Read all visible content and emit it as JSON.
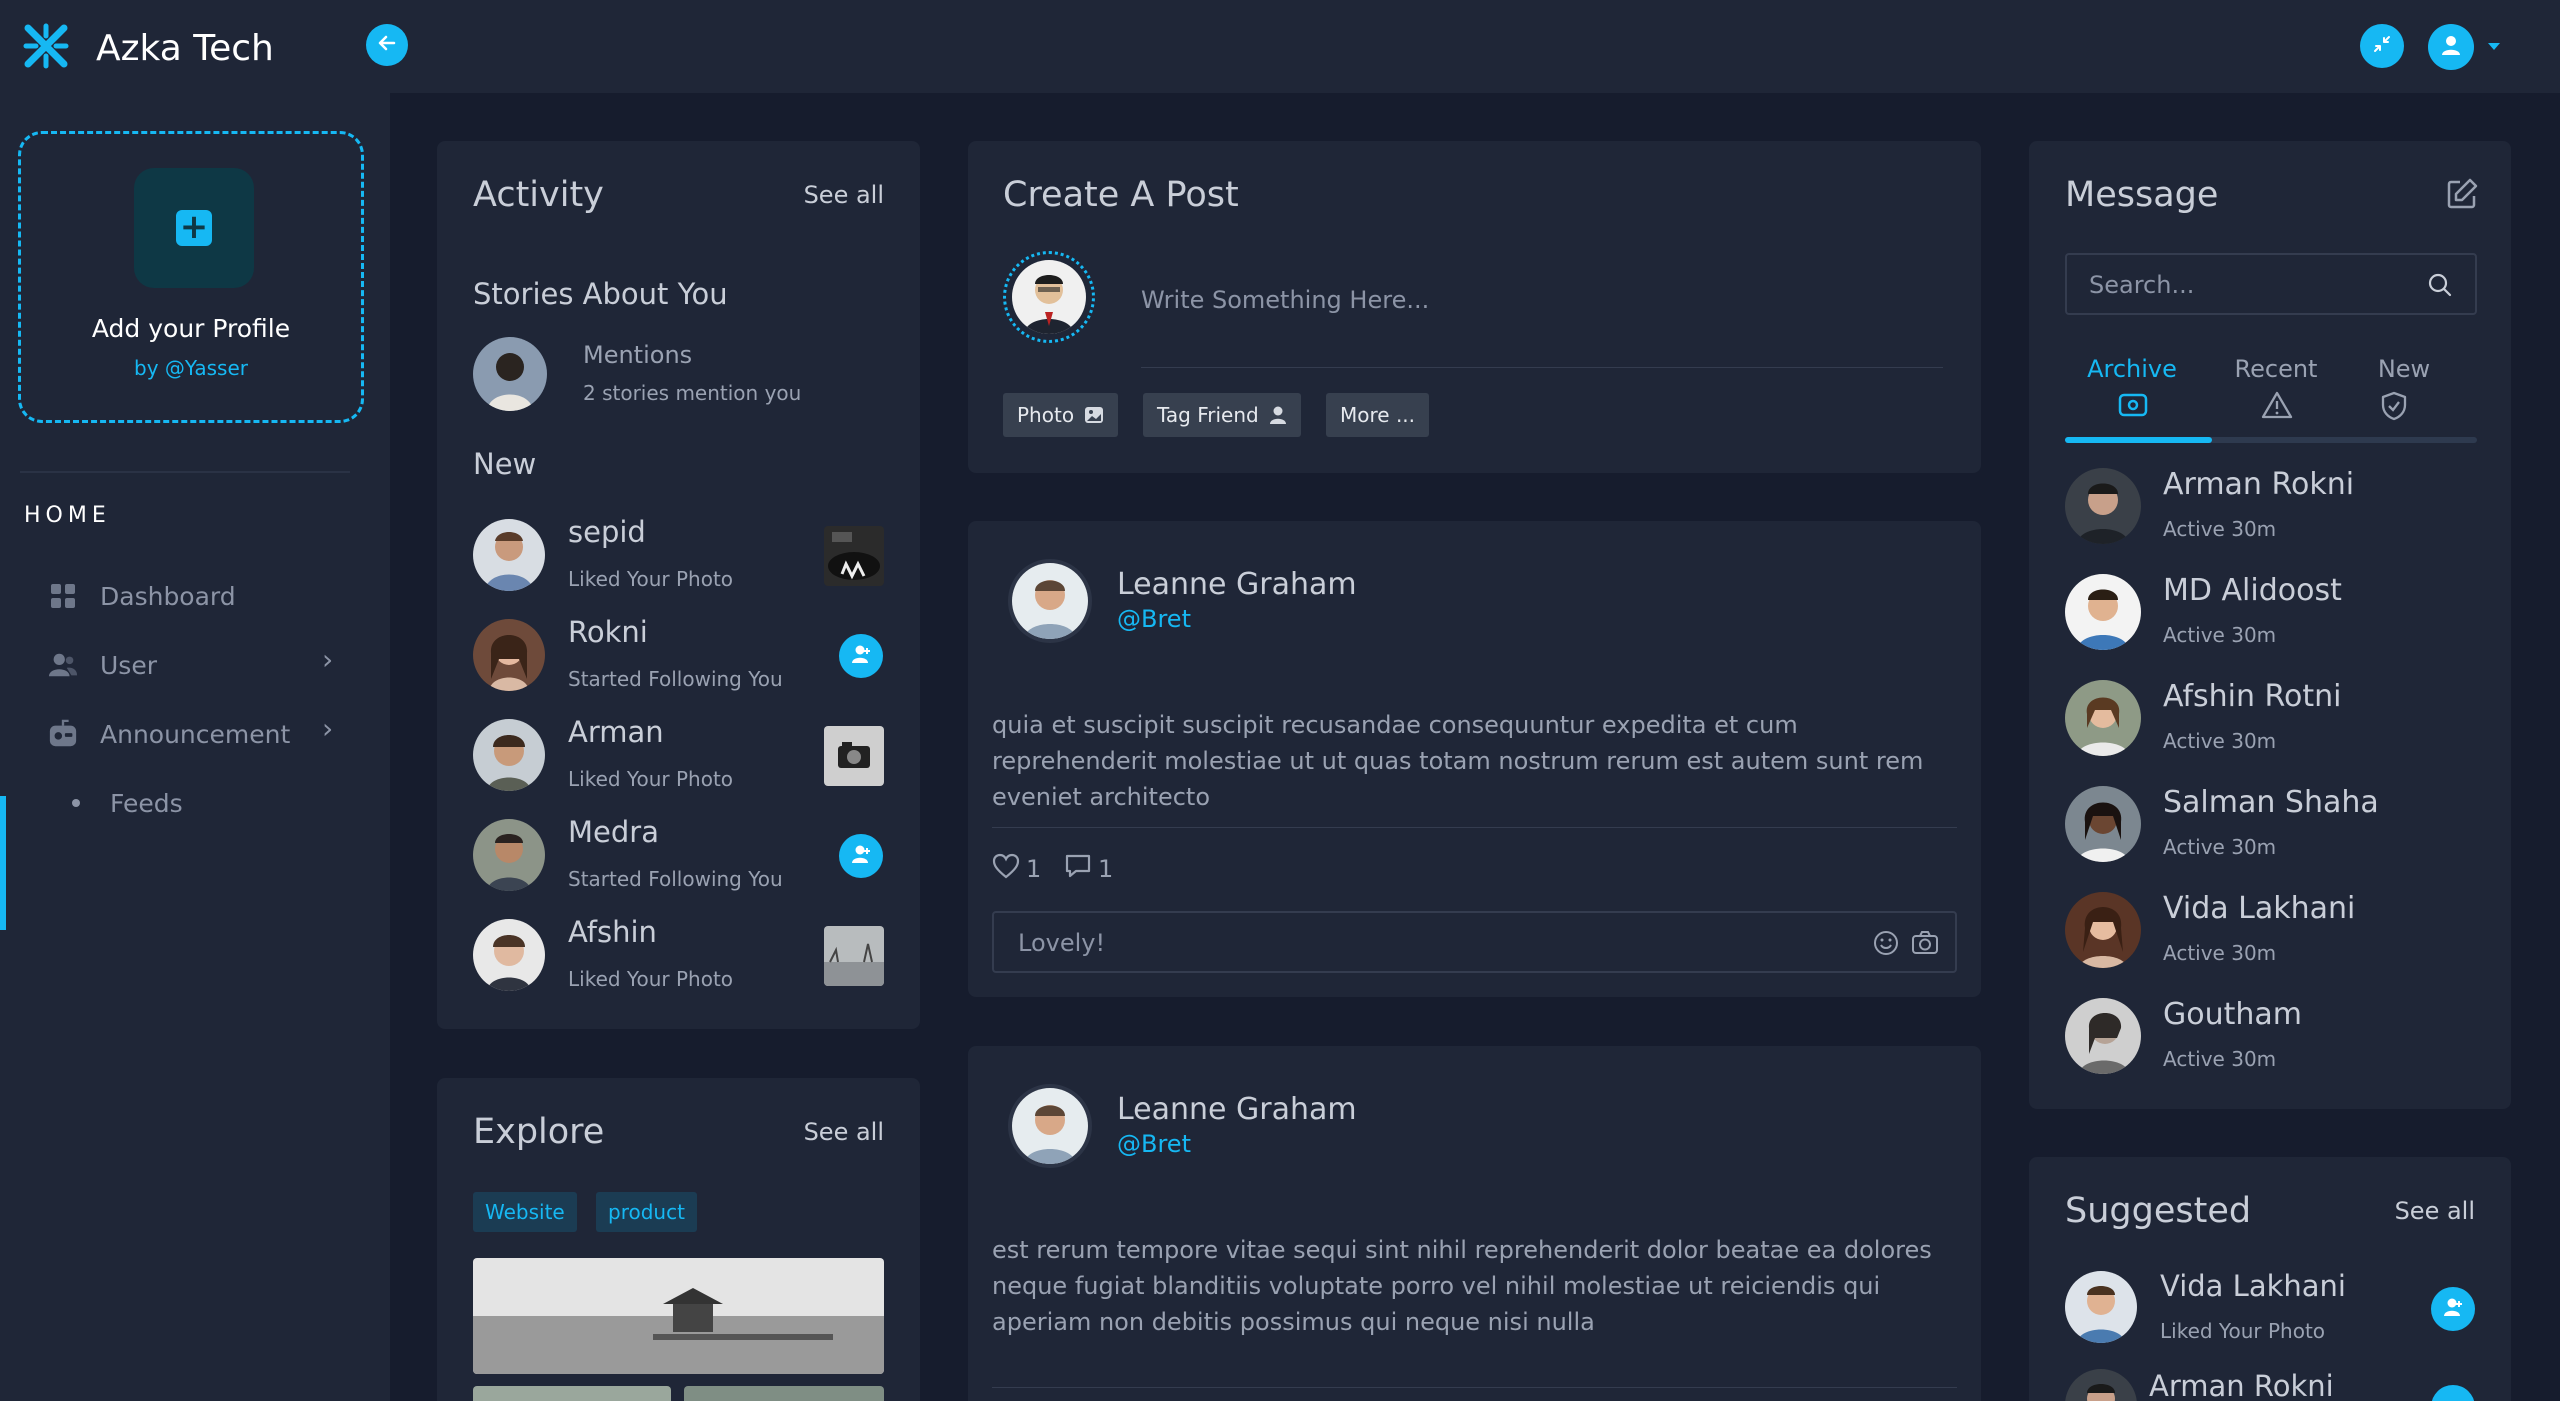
{
  "app": {
    "title": "Azka Tech"
  },
  "sidebar": {
    "profile": {
      "title": "Add your Profile",
      "subtitle": "by @Yasser"
    },
    "section_label": "HOME",
    "items": [
      {
        "label": "Dashboard"
      },
      {
        "label": "User"
      },
      {
        "label": "Announcement"
      },
      {
        "label": "Feeds"
      }
    ]
  },
  "activity": {
    "title": "Activity",
    "see_all": "See all",
    "stories_heading": "Stories About You",
    "mentions": {
      "title": "Mentions",
      "sub": "2 stories mention you"
    },
    "new_heading": "New",
    "items": [
      {
        "name": "sepid",
        "action": "Liked Your Photo"
      },
      {
        "name": "Rokni",
        "action": "Started Following You"
      },
      {
        "name": "Arman",
        "action": "Liked Your Photo"
      },
      {
        "name": "Medra",
        "action": "Started Following You"
      },
      {
        "name": "Afshin",
        "action": "Liked Your Photo"
      }
    ]
  },
  "explore": {
    "title": "Explore",
    "see_all": "See all",
    "tags": [
      "Website",
      "product"
    ]
  },
  "create_post": {
    "title": "Create A Post",
    "placeholder": "Write Something Here...",
    "buttons": [
      "Photo",
      "Tag Friend",
      "More ..."
    ]
  },
  "posts": [
    {
      "name": "Leanne Graham",
      "handle": "@Bret",
      "body": "quia et suscipit suscipit recusandae consequuntur expedita et cum reprehenderit molestiae ut ut quas totam nostrum rerum est autem sunt rem eveniet architecto",
      "likes": "1",
      "comments": "1",
      "comment_placeholder": "Lovely!"
    },
    {
      "name": "Leanne Graham",
      "handle": "@Bret",
      "body": "est rerum tempore vitae sequi sint nihil reprehenderit dolor beatae ea dolores neque fugiat blanditiis voluptate porro vel nihil molestiae ut reiciendis qui aperiam non debitis possimus qui neque nisi nulla"
    }
  ],
  "message": {
    "title": "Message",
    "search_placeholder": "Search...",
    "tabs": [
      "Archive",
      "Recent",
      "New"
    ],
    "contacts": [
      {
        "name": "Arman Rokni",
        "status": "Active 30m"
      },
      {
        "name": "MD Alidoost",
        "status": "Active 30m"
      },
      {
        "name": "Afshin Rotni",
        "status": "Active 30m"
      },
      {
        "name": "Salman Shaha",
        "status": "Active 30m"
      },
      {
        "name": "Vida Lakhani",
        "status": "Active 30m"
      },
      {
        "name": "Goutham",
        "status": "Active 30m"
      }
    ]
  },
  "suggested": {
    "title": "Suggested",
    "see_all": "See all",
    "items": [
      {
        "name": "Vida Lakhani",
        "action": "Liked Your Photo"
      },
      {
        "name": "Arman Rokni"
      }
    ]
  },
  "colors": {
    "accent": "#16b8f3",
    "panel": "#1f2637",
    "background": "#161c2d"
  }
}
